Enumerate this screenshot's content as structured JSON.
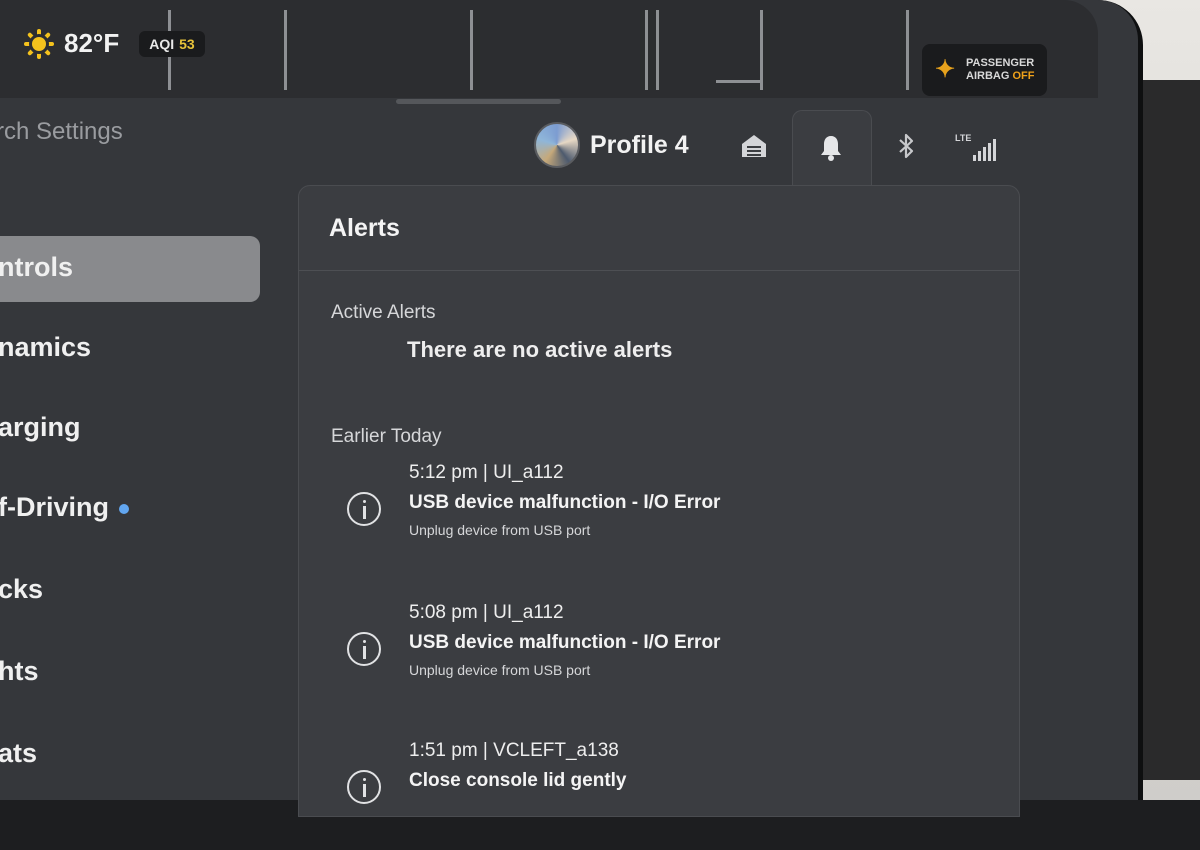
{
  "status_bar": {
    "weather_icon": "sun-icon",
    "temperature": "82°F",
    "aqi_label": "AQI",
    "aqi_value": "53",
    "airbag_line1": "PASSENGER",
    "airbag_word": "AIRBAG",
    "airbag_state": "OFF"
  },
  "header": {
    "search_text": "rch Settings",
    "profile_name": "Profile 4",
    "icons": [
      "garage-icon",
      "bell-icon",
      "bluetooth-icon",
      "lte-signal-icon"
    ],
    "lte_label": "LTE"
  },
  "sidebar": {
    "items": [
      {
        "label": "ntrols",
        "selected": true
      },
      {
        "label": "namics"
      },
      {
        "label": "arging"
      },
      {
        "label": "f-Driving",
        "dot": true
      },
      {
        "label": "cks"
      },
      {
        "label": "hts"
      },
      {
        "label": "ats"
      }
    ]
  },
  "alerts": {
    "title": "Alerts",
    "active_heading": "Active Alerts",
    "active_empty": "There are no active alerts",
    "earlier_heading": "Earlier Today",
    "items": [
      {
        "time": "5:12 pm | UI_a112",
        "title": "USB device malfunction - I/O Error",
        "subtitle": "Unplug device from USB port"
      },
      {
        "time": "5:08 pm | UI_a112",
        "title": "USB device malfunction - I/O Error",
        "subtitle": "Unplug device from USB port"
      },
      {
        "time": "1:51 pm | VCLEFT_a138",
        "title": "Close console lid gently"
      }
    ]
  },
  "colors": {
    "screen": "#35373b",
    "panel": "#3b3d41",
    "aqi_value": "#e6c23a",
    "airbag_off": "#f0a21a",
    "autopilot_dot": "#62a6f0"
  }
}
